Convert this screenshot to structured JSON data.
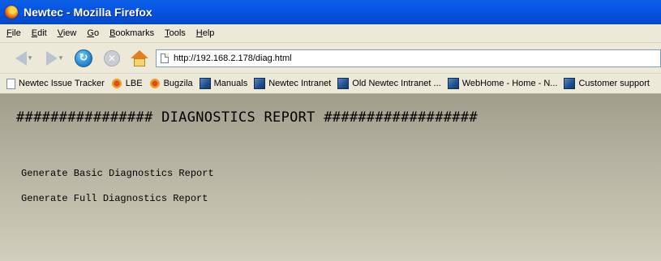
{
  "window": {
    "title": "Newtec - Mozilla Firefox"
  },
  "menu": {
    "items": [
      "File",
      "Edit",
      "View",
      "Go",
      "Bookmarks",
      "Tools",
      "Help"
    ]
  },
  "navigation": {
    "url": "http://192.168.2.178/diag.html",
    "icons": [
      "back-icon",
      "forward-icon",
      "reload-icon",
      "stop-icon",
      "home-icon",
      "page-icon"
    ]
  },
  "bookmarks": [
    {
      "label": "Newtec Issue Tracker",
      "icon": "page-icon"
    },
    {
      "label": "LBE",
      "icon": "bug-icon"
    },
    {
      "label": "Bugzila",
      "icon": "bug-icon"
    },
    {
      "label": "Manuals",
      "icon": "blue-folder-icon"
    },
    {
      "label": "Newtec Intranet",
      "icon": "blue-folder-icon"
    },
    {
      "label": "Old Newtec Intranet ...",
      "icon": "blue-folder-icon"
    },
    {
      "label": "WebHome - Home - N...",
      "icon": "blue-folder-icon"
    },
    {
      "label": "Customer support",
      "icon": "blue-folder-icon"
    }
  ],
  "page": {
    "title": "################ DIAGNOSTICS REPORT ##################",
    "links": [
      "Generate Basic Diagnostics Report",
      "Generate Full Diagnostics Report"
    ]
  },
  "colors": {
    "titlebar": "#0553e0",
    "chrome": "#ece9d8",
    "content_top": "#a29e8c",
    "content_bottom": "#d2cebd"
  }
}
